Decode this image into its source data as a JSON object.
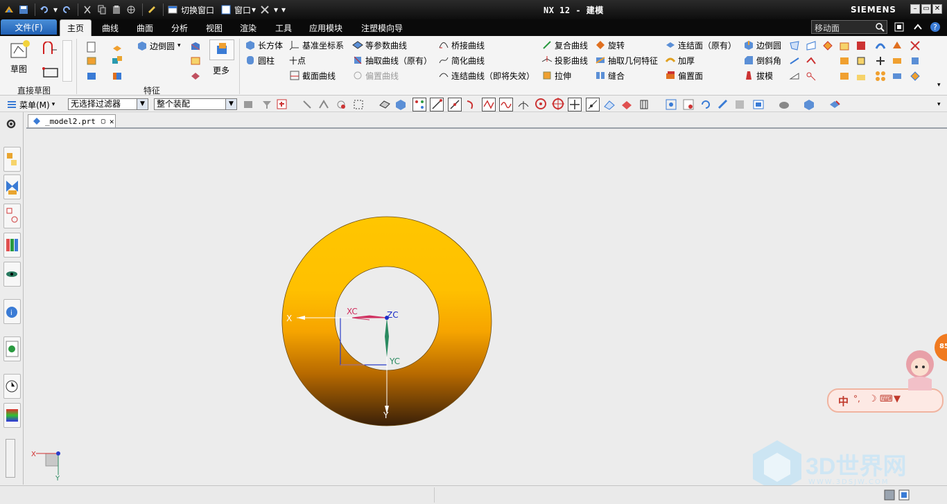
{
  "window": {
    "title": "NX 12 - 建模",
    "brand": "SIEMENS"
  },
  "quick_access": {
    "switch_window": "切换窗口",
    "window_menu": "窗口"
  },
  "menubar": {
    "file": "文件(F)",
    "tabs": [
      "主页",
      "曲线",
      "曲面",
      "分析",
      "视图",
      "渲染",
      "工具",
      "应用模块",
      "注塑模向导"
    ],
    "active_tab": "主页",
    "search_placeholder": "移动面"
  },
  "ribbon": {
    "sketch_label": "草图",
    "direct_sketch_group": "直接草图",
    "feature_group": "特征",
    "more_label": "更多",
    "edge_blend": "边倒圆",
    "col1": [
      "长方体",
      "圆柱"
    ],
    "col2": [
      "基准坐标系",
      "十点",
      "截面曲线"
    ],
    "col3": [
      "等参数曲线",
      "抽取曲线（原有）",
      "偏置曲线"
    ],
    "col4": [
      "桥接曲线",
      "简化曲线",
      "连结曲线（即将失效）"
    ],
    "col5": [
      "复合曲线",
      "投影曲线",
      "拉伸"
    ],
    "col6": [
      "旋转",
      "抽取几何特征",
      "缝合"
    ],
    "col7": [
      "连结面（原有）",
      "加厚",
      "偏置面"
    ],
    "col8": [
      "边倒圆",
      "倒斜角",
      "拔模"
    ]
  },
  "toolbar": {
    "menu": "菜单(M)",
    "filter": "无选择过滤器",
    "assembly": "整个装配"
  },
  "document": {
    "tab": "_model2.prt"
  },
  "view": {
    "axis_x": "X",
    "axis_y": "Y",
    "axis_xc": "XC",
    "axis_yc": "YC",
    "axis_zc": "ZC",
    "mini_x": "X",
    "mini_y": "Y"
  },
  "widget": {
    "badge": "85",
    "ime_text": "中",
    "ime_symbols": "°,"
  },
  "watermark": {
    "text": "3D世界网",
    "url": "WWW.3DSJW.COM"
  },
  "colors": {
    "ring_top": "#ffc200",
    "ring_bottom": "#3a2008",
    "accent": "#1f5fb4"
  }
}
